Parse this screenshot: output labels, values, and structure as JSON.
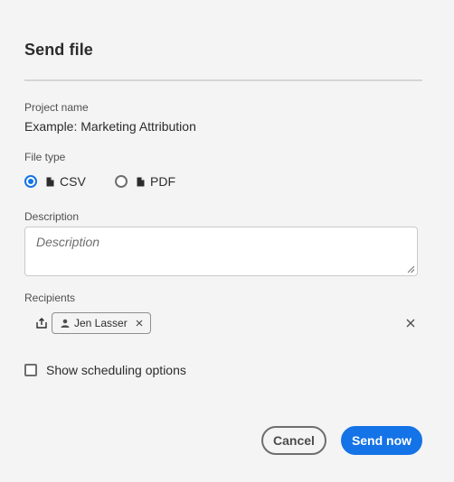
{
  "dialog": {
    "title": "Send file"
  },
  "project": {
    "label": "Project name",
    "value": "Example: Marketing Attribution"
  },
  "file_type": {
    "label": "File type",
    "options": [
      {
        "label": "CSV",
        "selected": true,
        "icon": "file-icon"
      },
      {
        "label": "PDF",
        "selected": false,
        "icon": "file-icon"
      }
    ]
  },
  "description": {
    "label": "Description",
    "placeholder": "Description",
    "value": ""
  },
  "recipients": {
    "label": "Recipients",
    "tags": [
      {
        "name": "Jen Lasser",
        "icon": "person-icon"
      }
    ],
    "add_icon": "share-icon",
    "clear_icon": "close-icon"
  },
  "scheduling": {
    "label": "Show scheduling options",
    "checked": false
  },
  "actions": {
    "cancel_label": "Cancel",
    "send_label": "Send now"
  },
  "colors": {
    "accent": "#1473e6",
    "background": "#f4f4f4",
    "text": "#2c2c2c"
  }
}
